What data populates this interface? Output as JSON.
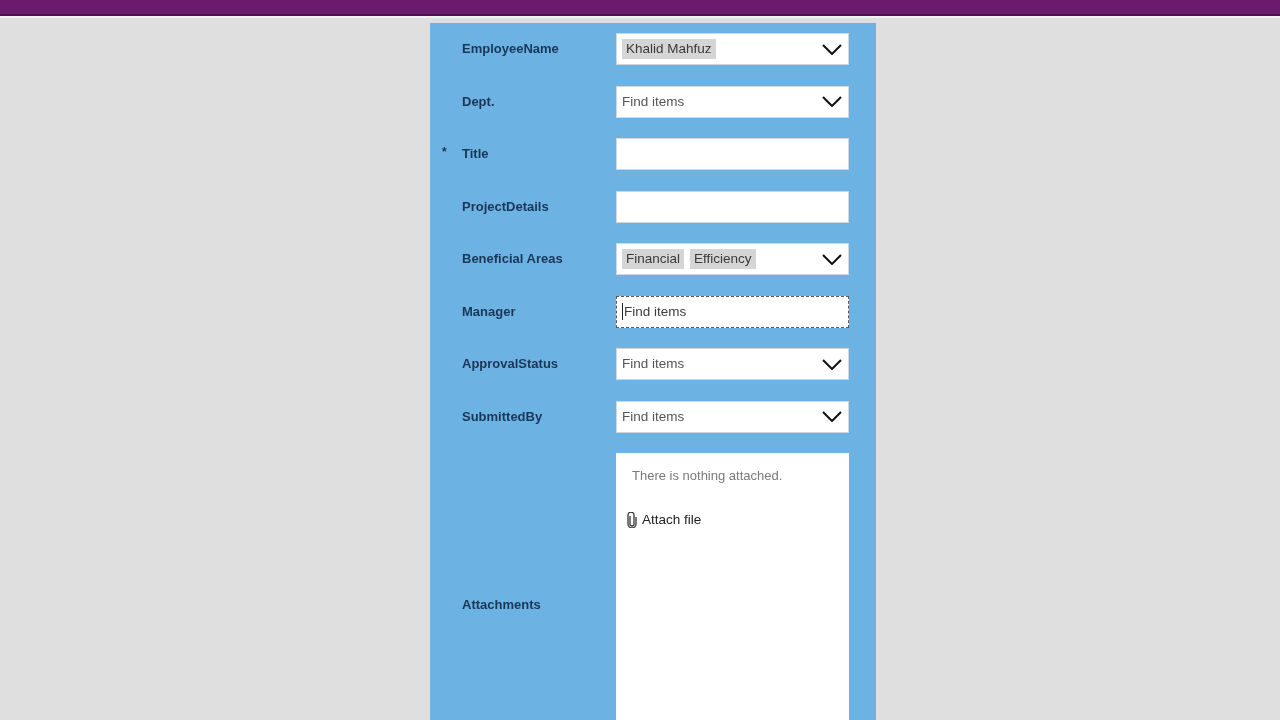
{
  "form": {
    "fields": [
      {
        "kind": "dropdown",
        "label": "EmployeeName",
        "tags": [
          "Khalid Mahfuz"
        ],
        "focused": false
      },
      {
        "kind": "dropdown",
        "label": "Dept.",
        "placeholder": "Find items",
        "focused": false
      },
      {
        "kind": "text",
        "label": "Title",
        "required_mark": "*",
        "focused": false
      },
      {
        "kind": "text",
        "label": "ProjectDetails",
        "focused": false
      },
      {
        "kind": "dropdown",
        "label": "Beneficial Areas",
        "tags": [
          "Financial",
          "Efficiency"
        ],
        "focused": false
      },
      {
        "kind": "dropdown",
        "label": "Manager",
        "placeholder": "Find items",
        "focused": true
      },
      {
        "kind": "dropdown",
        "label": "ApprovalStatus",
        "placeholder": "Find items",
        "focused": false
      },
      {
        "kind": "dropdown",
        "label": "SubmittedBy",
        "placeholder": "Find items",
        "focused": false
      },
      {
        "kind": "attachments",
        "label": "Attachments",
        "empty_text": "There is nothing attached.",
        "action": "Attach file",
        "focused": false
      }
    ]
  }
}
